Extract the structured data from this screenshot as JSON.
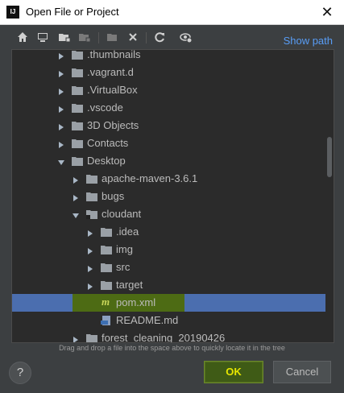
{
  "window": {
    "title": "Open File or Project",
    "close_glyph": "✕",
    "app_icon_text": "IJ"
  },
  "toolbar": {
    "buttons": [
      {
        "icon": "home-icon"
      },
      {
        "icon": "desktop-icon"
      },
      {
        "icon": "project-folder-icon"
      },
      {
        "icon": "module-folder-icon"
      },
      {
        "icon": "new-folder-icon"
      },
      {
        "icon": "delete-icon"
      },
      {
        "icon": "refresh-icon"
      },
      {
        "icon": "show-hidden-icon"
      }
    ],
    "show_path_label": "Show path"
  },
  "tree": {
    "rows": [
      {
        "label": ".thumbnails",
        "expanded": false,
        "type": "folder"
      },
      {
        "label": ".vagrant.d",
        "expanded": false,
        "type": "folder"
      },
      {
        "label": ".VirtualBox",
        "expanded": false,
        "type": "folder"
      },
      {
        "label": ".vscode",
        "expanded": false,
        "type": "folder"
      },
      {
        "label": "3D Objects",
        "expanded": false,
        "type": "folder"
      },
      {
        "label": "Contacts",
        "expanded": false,
        "type": "folder"
      },
      {
        "label": "Desktop",
        "expanded": true,
        "type": "folder"
      },
      {
        "label": "apache-maven-3.6.1",
        "expanded": false,
        "type": "folder"
      },
      {
        "label": "bugs",
        "expanded": false,
        "type": "folder"
      },
      {
        "label": "cloudant",
        "expanded": true,
        "type": "project-folder"
      },
      {
        "label": ".idea",
        "expanded": false,
        "type": "folder"
      },
      {
        "label": "img",
        "expanded": false,
        "type": "folder"
      },
      {
        "label": "src",
        "expanded": false,
        "type": "folder"
      },
      {
        "label": "target",
        "expanded": false,
        "type": "folder"
      },
      {
        "label": "pom.xml",
        "type": "maven-file",
        "selected": true
      },
      {
        "label": "README.md",
        "type": "markdown-file"
      },
      {
        "label": "forest_cleaning_20190426",
        "expanded": false,
        "type": "folder"
      }
    ]
  },
  "hint": "Drag and drop a file into the space above to quickly locate it in the tree",
  "buttons": {
    "help": "?",
    "ok": "OK",
    "cancel": "Cancel"
  },
  "colors": {
    "selection": "#4b6eaf",
    "ok_text": "#e6e600",
    "link": "#589df6"
  }
}
